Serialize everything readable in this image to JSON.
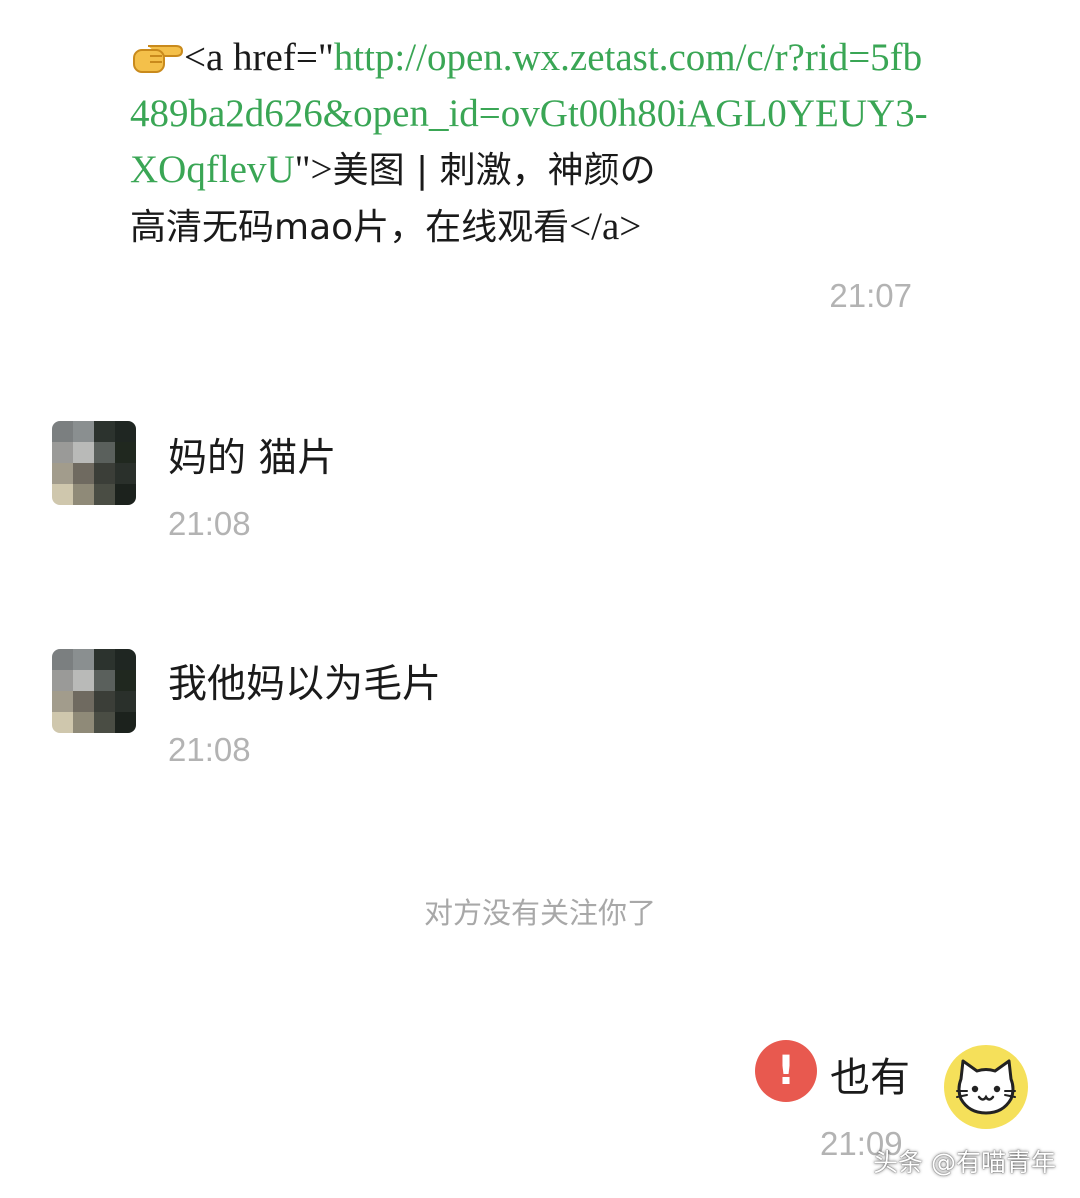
{
  "messages": [
    {
      "sender": "other",
      "parts": {
        "pre": "<a href=\"",
        "url": "http://open.wx.zetast.com/c/r?rid=5fb489ba2d626&open_id=ovGt00h80iAGL0YEUY3-XOqflevU",
        "mid": "\">",
        "title_a": "美图 | 刺激，神颜の",
        "title_b": "高清无码mao片，在线观看",
        "post": "</a>"
      },
      "time": "21:07"
    },
    {
      "sender": "other",
      "text": "妈的 猫片",
      "time": "21:08"
    },
    {
      "sender": "other",
      "text": "我他妈以为毛片",
      "time": "21:08"
    }
  ],
  "system_note": "对方没有关注你了",
  "my_message": {
    "text": "也有",
    "status_icon": "!",
    "status": "send-failed",
    "time": "21:09"
  },
  "watermark": "头条 @有喵青年",
  "colors": {
    "link": "#3aa655",
    "error": "#e8594f",
    "avatar_yellow": "#f5e05a",
    "time_gray": "#b3b3b3"
  }
}
